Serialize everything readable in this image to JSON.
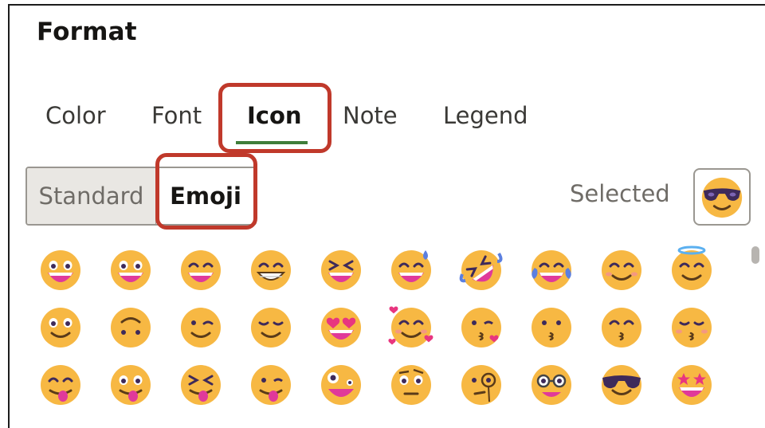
{
  "panel": {
    "title": "Format"
  },
  "tabs": [
    {
      "label": "Color",
      "active": false
    },
    {
      "label": "Font",
      "active": false
    },
    {
      "label": "Icon",
      "active": true
    },
    {
      "label": "Note",
      "active": false
    },
    {
      "label": "Legend",
      "active": false
    }
  ],
  "icon_type": {
    "standard_label": "Standard",
    "emoji_label": "Emoji",
    "selected_value": "Emoji"
  },
  "selected": {
    "label": "Selected",
    "emoji": "smiling-face-with-sunglasses"
  },
  "emoji_rows": [
    [
      "grinning-face",
      "grinning-face-big-eyes",
      "grinning-face-smiling-eyes",
      "beaming-face",
      "grinning-squinting-face",
      "grinning-face-sweat",
      "rolling-on-floor-laughing",
      "face-tears-of-joy",
      "smiling-face-smiling-eyes",
      "smiling-face-halo"
    ],
    [
      "slightly-smiling-face",
      "upside-down-face",
      "winking-face",
      "relieved-face",
      "smiling-face-heart-eyes",
      "smiling-face-with-hearts",
      "face-blowing-kiss",
      "kissing-face",
      "kissing-face-smiling-eyes",
      "kissing-face-closed-eyes"
    ],
    [
      "face-savoring-food",
      "face-with-tongue",
      "squinting-face-tongue",
      "winking-face-tongue",
      "zany-face",
      "face-raised-eyebrow",
      "face-with-monocle",
      "nerd-face",
      "smiling-face-sunglasses",
      "star-struck"
    ]
  ],
  "colors": {
    "accent_underline": "#3f7d3a",
    "annotation": "#c0392b",
    "emoji_yellow": "#f7b843",
    "mouth": "#e0399a",
    "eye": "#3e2a5a"
  }
}
